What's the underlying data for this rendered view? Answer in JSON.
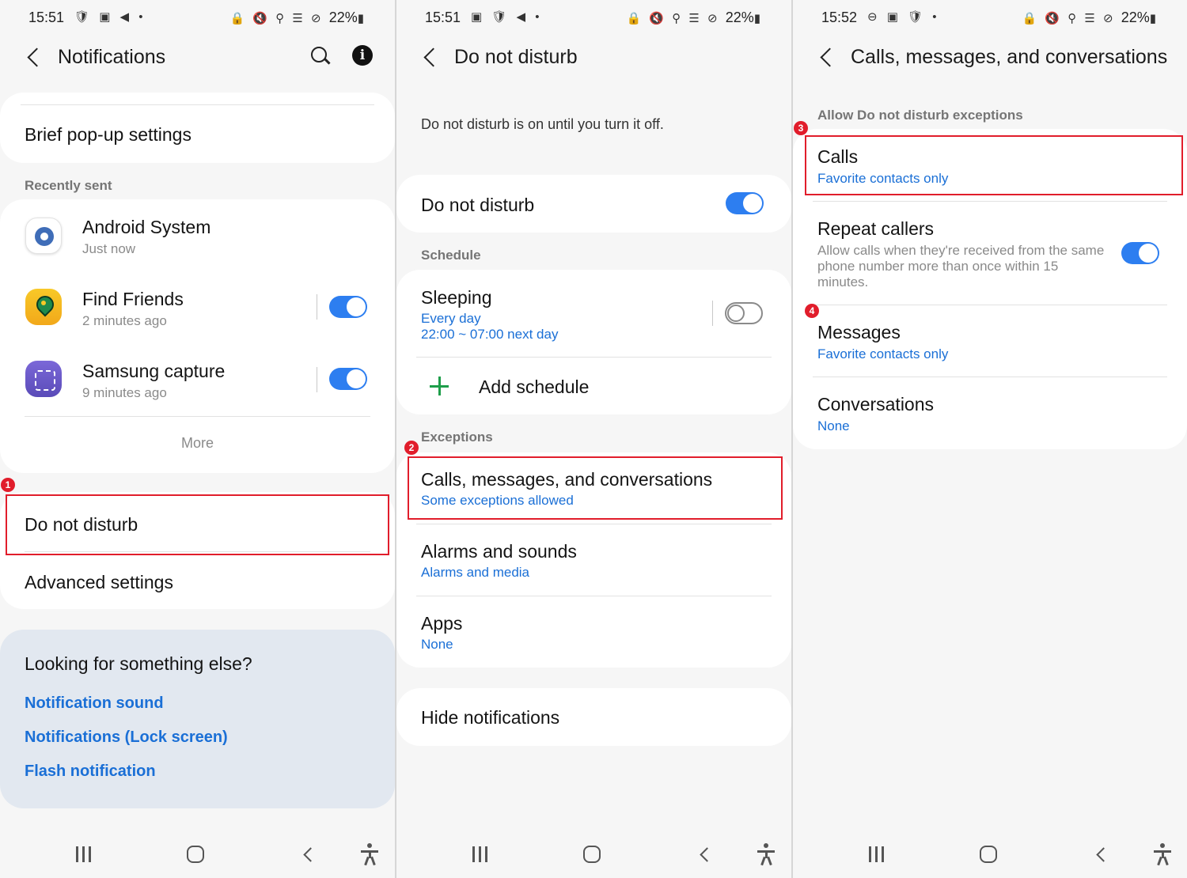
{
  "screens": [
    {
      "status": {
        "time": "15:51",
        "left_icons": "🛡 ▣ ◀ •",
        "right_icons": "🔒 🔇 ⚲ ☰ ⊘",
        "battery": "22%"
      },
      "title": "Notifications",
      "brief_popup": "Brief pop-up settings",
      "recently_sent_label": "Recently sent",
      "apps": [
        {
          "name": "Android System",
          "time": "Just now",
          "icon": "android-system-icon"
        },
        {
          "name": "Find Friends",
          "time": "2 minutes ago",
          "icon": "find-friends-icon",
          "toggle": true
        },
        {
          "name": "Samsung capture",
          "time": "9 minutes ago",
          "icon": "samsung-capture-icon",
          "toggle": true
        }
      ],
      "more": "More",
      "do_not_disturb": "Do not disturb",
      "advanced": "Advanced settings",
      "looking_title": "Looking for something else?",
      "links": [
        "Notification sound",
        "Notifications (Lock screen)",
        "Flash notification"
      ],
      "badge": "1"
    },
    {
      "status": {
        "time": "15:51",
        "left_icons": "▣ 🛡 ◀ •",
        "right_icons": "🔒 🔇 ⚲ ☰ ⊘",
        "battery": "22%"
      },
      "title": "Do not disturb",
      "description": "Do not disturb is on until you turn it off.",
      "dnd_label": "Do not disturb",
      "dnd_on": true,
      "schedule_label": "Schedule",
      "sleeping": {
        "title": "Sleeping",
        "days": "Every day",
        "time": "22:00 ~ 07:00 next day",
        "on": false
      },
      "add_schedule": "Add schedule",
      "exceptions_label": "Exceptions",
      "exceptions": [
        {
          "title": "Calls, messages, and conversations",
          "sub": "Some exceptions allowed"
        },
        {
          "title": "Alarms and sounds",
          "sub": "Alarms and media"
        },
        {
          "title": "Apps",
          "sub": "None"
        }
      ],
      "hide_notifications": "Hide notifications",
      "badge": "2"
    },
    {
      "status": {
        "time": "15:52",
        "left_icons": "⊖ ▣ 🛡 •",
        "right_icons": "🔒 🔇 ⚲ ☰ ⊘",
        "battery": "22%"
      },
      "title": "Calls, messages, and conversations",
      "section_label": "Allow Do not disturb exceptions",
      "calls": {
        "title": "Calls",
        "sub": "Favorite contacts only"
      },
      "repeat_callers": {
        "title": "Repeat callers",
        "sub": "Allow calls when they're received from the same phone number more than once within 15 minutes.",
        "on": true
      },
      "messages": {
        "title": "Messages",
        "sub": "Favorite contacts only"
      },
      "conversations": {
        "title": "Conversations",
        "sub": "None"
      },
      "badge_calls": "3",
      "badge_messages": "4"
    }
  ],
  "colors": {
    "accent": "#2d7ef0",
    "link": "#1a6fd6",
    "highlight": "#e11d2b",
    "panel_bg": "#f6f6f6",
    "tip_bg": "#e2e8f0"
  }
}
